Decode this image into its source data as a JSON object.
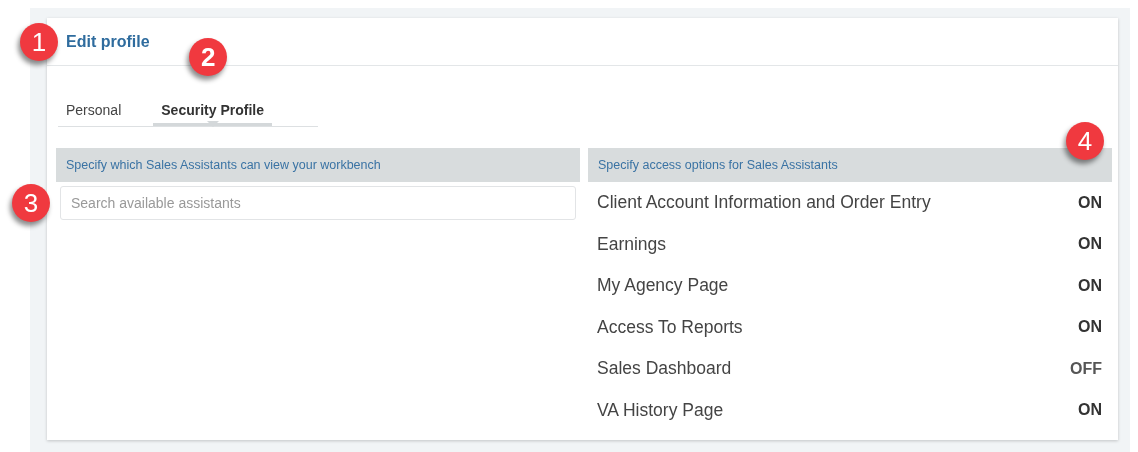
{
  "header": {
    "title": "Edit profile",
    "badge": "1"
  },
  "tabs": [
    {
      "label": "Personal",
      "selected": false
    },
    {
      "label": "Security Profile",
      "selected": true,
      "badge": "2"
    }
  ],
  "assistants_panel": {
    "heading": "Specify which Sales Assistants can view your workbench",
    "search": {
      "placeholder": "Search available assistants",
      "badge": "3"
    }
  },
  "access_panel": {
    "heading": "Specify access options for Sales Assistants",
    "badge": "4",
    "options": [
      {
        "label": "Client Account Information and Order Entry",
        "value": "ON"
      },
      {
        "label": "Earnings",
        "value": "ON"
      },
      {
        "label": "My Agency Page",
        "value": "ON"
      },
      {
        "label": "Access To Reports",
        "value": "ON"
      },
      {
        "label": "Sales Dashboard",
        "value": "OFF"
      },
      {
        "label": "VA History Page",
        "value": "ON"
      }
    ]
  }
}
